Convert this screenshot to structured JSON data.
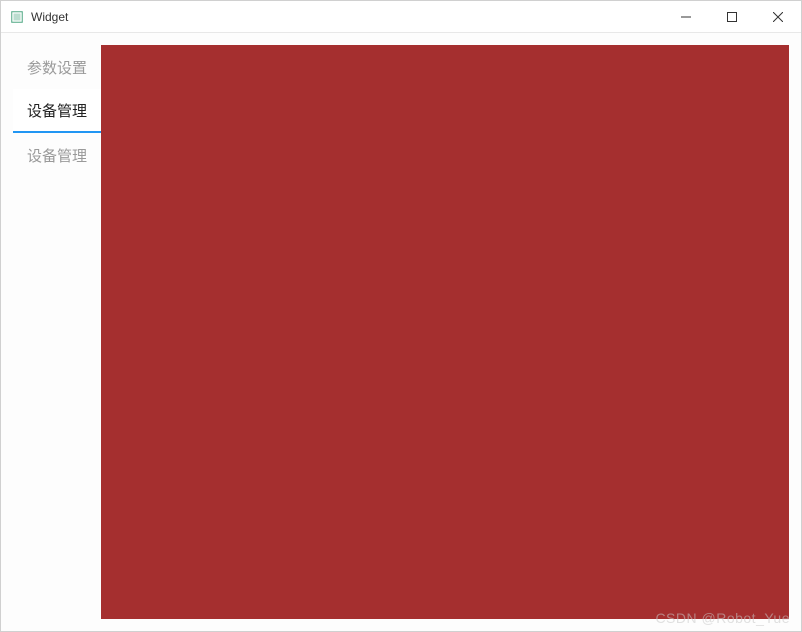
{
  "window": {
    "title": "Widget"
  },
  "tabs": {
    "items": [
      {
        "label": "参数设置",
        "active": false
      },
      {
        "label": "设备管理",
        "active": true
      },
      {
        "label": "设备管理",
        "active": false
      }
    ]
  },
  "content": {
    "background_color": "#a52f2f"
  },
  "watermark": {
    "text": "CSDN @Robot_Yue"
  }
}
